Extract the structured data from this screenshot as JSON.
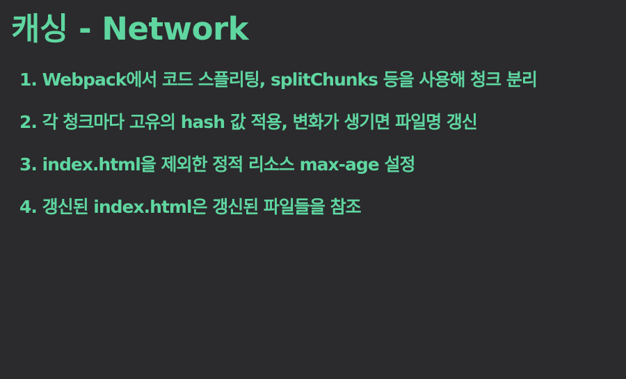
{
  "slide": {
    "title": "캐싱 - Network",
    "items": [
      "1. Webpack에서 코드 스플리팅, splitChunks 등을 사용해 청크 분리",
      "2. 각 청크마다 고유의 hash 값 적용, 변화가 생기면 파일명 갱신",
      "3. index.html을 제외한 정적 리소스 max-age 설정",
      "4. 갱신된 index.html은 갱신된 파일들을 참조"
    ],
    "colors": {
      "background": "#2b2a2d",
      "text": "#5fd6a0"
    }
  }
}
